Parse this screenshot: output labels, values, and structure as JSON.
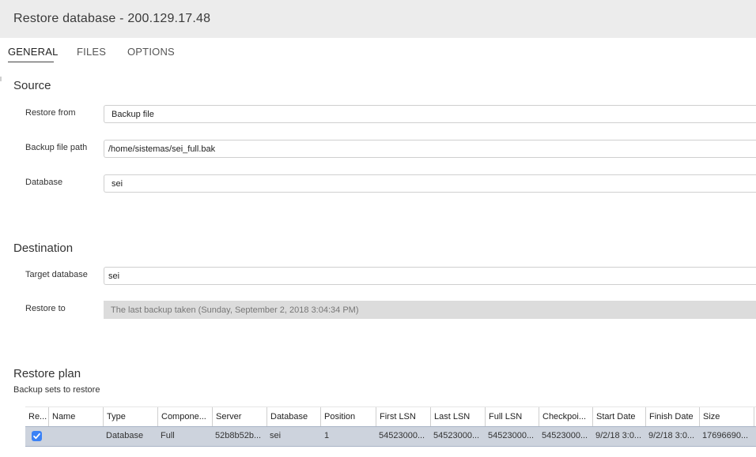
{
  "window": {
    "title": "Restore database - 200.129.17.48"
  },
  "tabs": [
    {
      "label": "GENERAL",
      "active": true
    },
    {
      "label": "FILES",
      "active": false
    },
    {
      "label": "OPTIONS",
      "active": false
    }
  ],
  "source": {
    "title": "Source",
    "restore_from": {
      "label": "Restore from",
      "value": "Backup file"
    },
    "backup_file_path": {
      "label": "Backup file path",
      "value": "/home/sistemas/sei_full.bak"
    },
    "database": {
      "label": "Database",
      "value": "sei"
    }
  },
  "destination": {
    "title": "Destination",
    "target_database": {
      "label": "Target database",
      "value": "sei"
    },
    "restore_to": {
      "label": "Restore to",
      "value": "The last backup taken (Sunday, September 2, 2018 3:04:34 PM)"
    }
  },
  "restore_plan": {
    "title": "Restore plan",
    "subtitle": "Backup sets to restore",
    "columns": [
      "Re...",
      "Name",
      "Type",
      "Compone...",
      "Server",
      "Database",
      "Position",
      "First LSN",
      "Last LSN",
      "Full LSN",
      "Checkpoi...",
      "Start Date",
      "Finish Date",
      "Size"
    ],
    "rows": [
      {
        "restore": true,
        "name": "",
        "type": "Database",
        "component": "Full",
        "server": "52b8b52b...",
        "database": "sei",
        "position": "1",
        "first_lsn": "54523000...",
        "last_lsn": "54523000...",
        "full_lsn": "54523000...",
        "checkpoint_lsn": "54523000...",
        "start_date": "9/2/18 3:0...",
        "finish_date": "9/2/18 3:0...",
        "size": "17696690..."
      }
    ]
  },
  "colors": {
    "selected_row": "#cdd3dd",
    "checkbox": "#3b82f6",
    "titlebar": "#ececec"
  }
}
